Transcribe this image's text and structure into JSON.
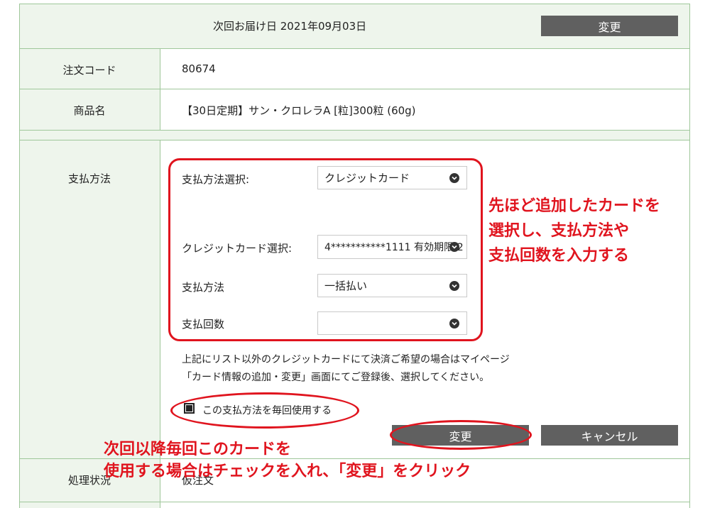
{
  "delivery": {
    "next_delivery_label": "次回お届け日 2021年09月03日",
    "change_button": "変更"
  },
  "order": {
    "code_label": "注文コード",
    "code_value": "80674",
    "product_label": "商品名",
    "product_value": "【30日定期】サン・クロレラA [粒]300粒 (60g)"
  },
  "payment": {
    "section_label": "支払方法",
    "method_select_label": "支払方法選択:",
    "method_select_value": "クレジットカード",
    "card_select_label": "クレジットカード選択:",
    "card_select_value": "4***********1111 有効期限:2",
    "pay_method_label": "支払方法",
    "pay_method_value": "一括払い",
    "installments_label": "支払回数",
    "installments_value": "",
    "note_line1": "上記にリスト以外のクレジットカードにて決済ご希望の場合はマイページ",
    "note_line2": "「カード情報の追加・変更」画面にてご登録後、選択してください。",
    "checkbox_label": "この支払方法を毎回使用する",
    "checkbox_checked": true,
    "change_button": "変更",
    "cancel_button": "キャンセル"
  },
  "status": {
    "label": "処理状況",
    "value": "仮注文"
  },
  "annotations": {
    "right_note_line1": "先ほど追加したカードを",
    "right_note_line2": "選択し、支払方法や",
    "right_note_line3": "支払回数を入力する",
    "bottom_note_line1": "次回以降毎回このカードを",
    "bottom_note_line2": "使用する場合はチェックを入れ、「変更」をクリック",
    "highlight_color": "#e0141e"
  },
  "colors": {
    "label_bg": "#eef5ec",
    "border": "#9fc79a",
    "button_bg": "#606060"
  }
}
